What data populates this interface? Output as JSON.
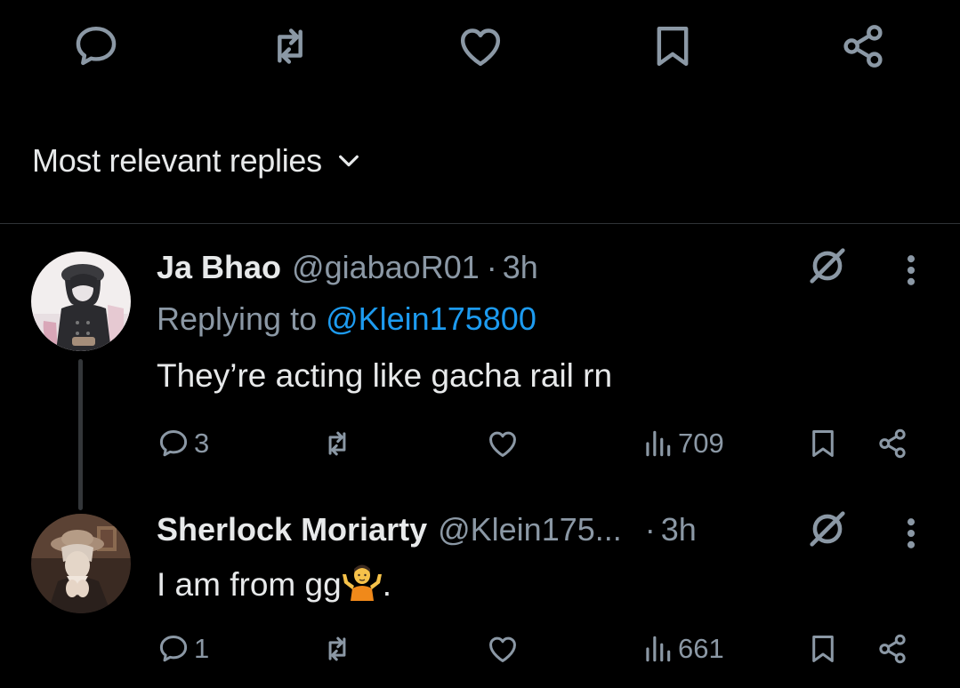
{
  "sort": {
    "label": "Most relevant replies"
  },
  "replies": [
    {
      "name": "Ja Bhao",
      "handle": "@giabaoR01",
      "separator": "·",
      "time": "3h",
      "replying_prefix": "Replying to ",
      "replying_mention": "@Klein175800",
      "text": "They’re acting like gacha rail rn",
      "counts": {
        "replies": "3",
        "views": "709"
      }
    },
    {
      "name": "Sherlock Moriarty",
      "handle": "@Klein175...",
      "separator": "·",
      "time": "3h",
      "text_before_emoji": "I am from gg",
      "emoji_name": "person-shrugging-emoji",
      "text_after_emoji": ".",
      "counts": {
        "replies": "1",
        "views": "661"
      }
    }
  ],
  "colors": {
    "background": "#000000",
    "text": "#e7e9ea",
    "secondary": "#8b98a5",
    "accent": "#1d9bf0",
    "divider": "#2f3336"
  }
}
